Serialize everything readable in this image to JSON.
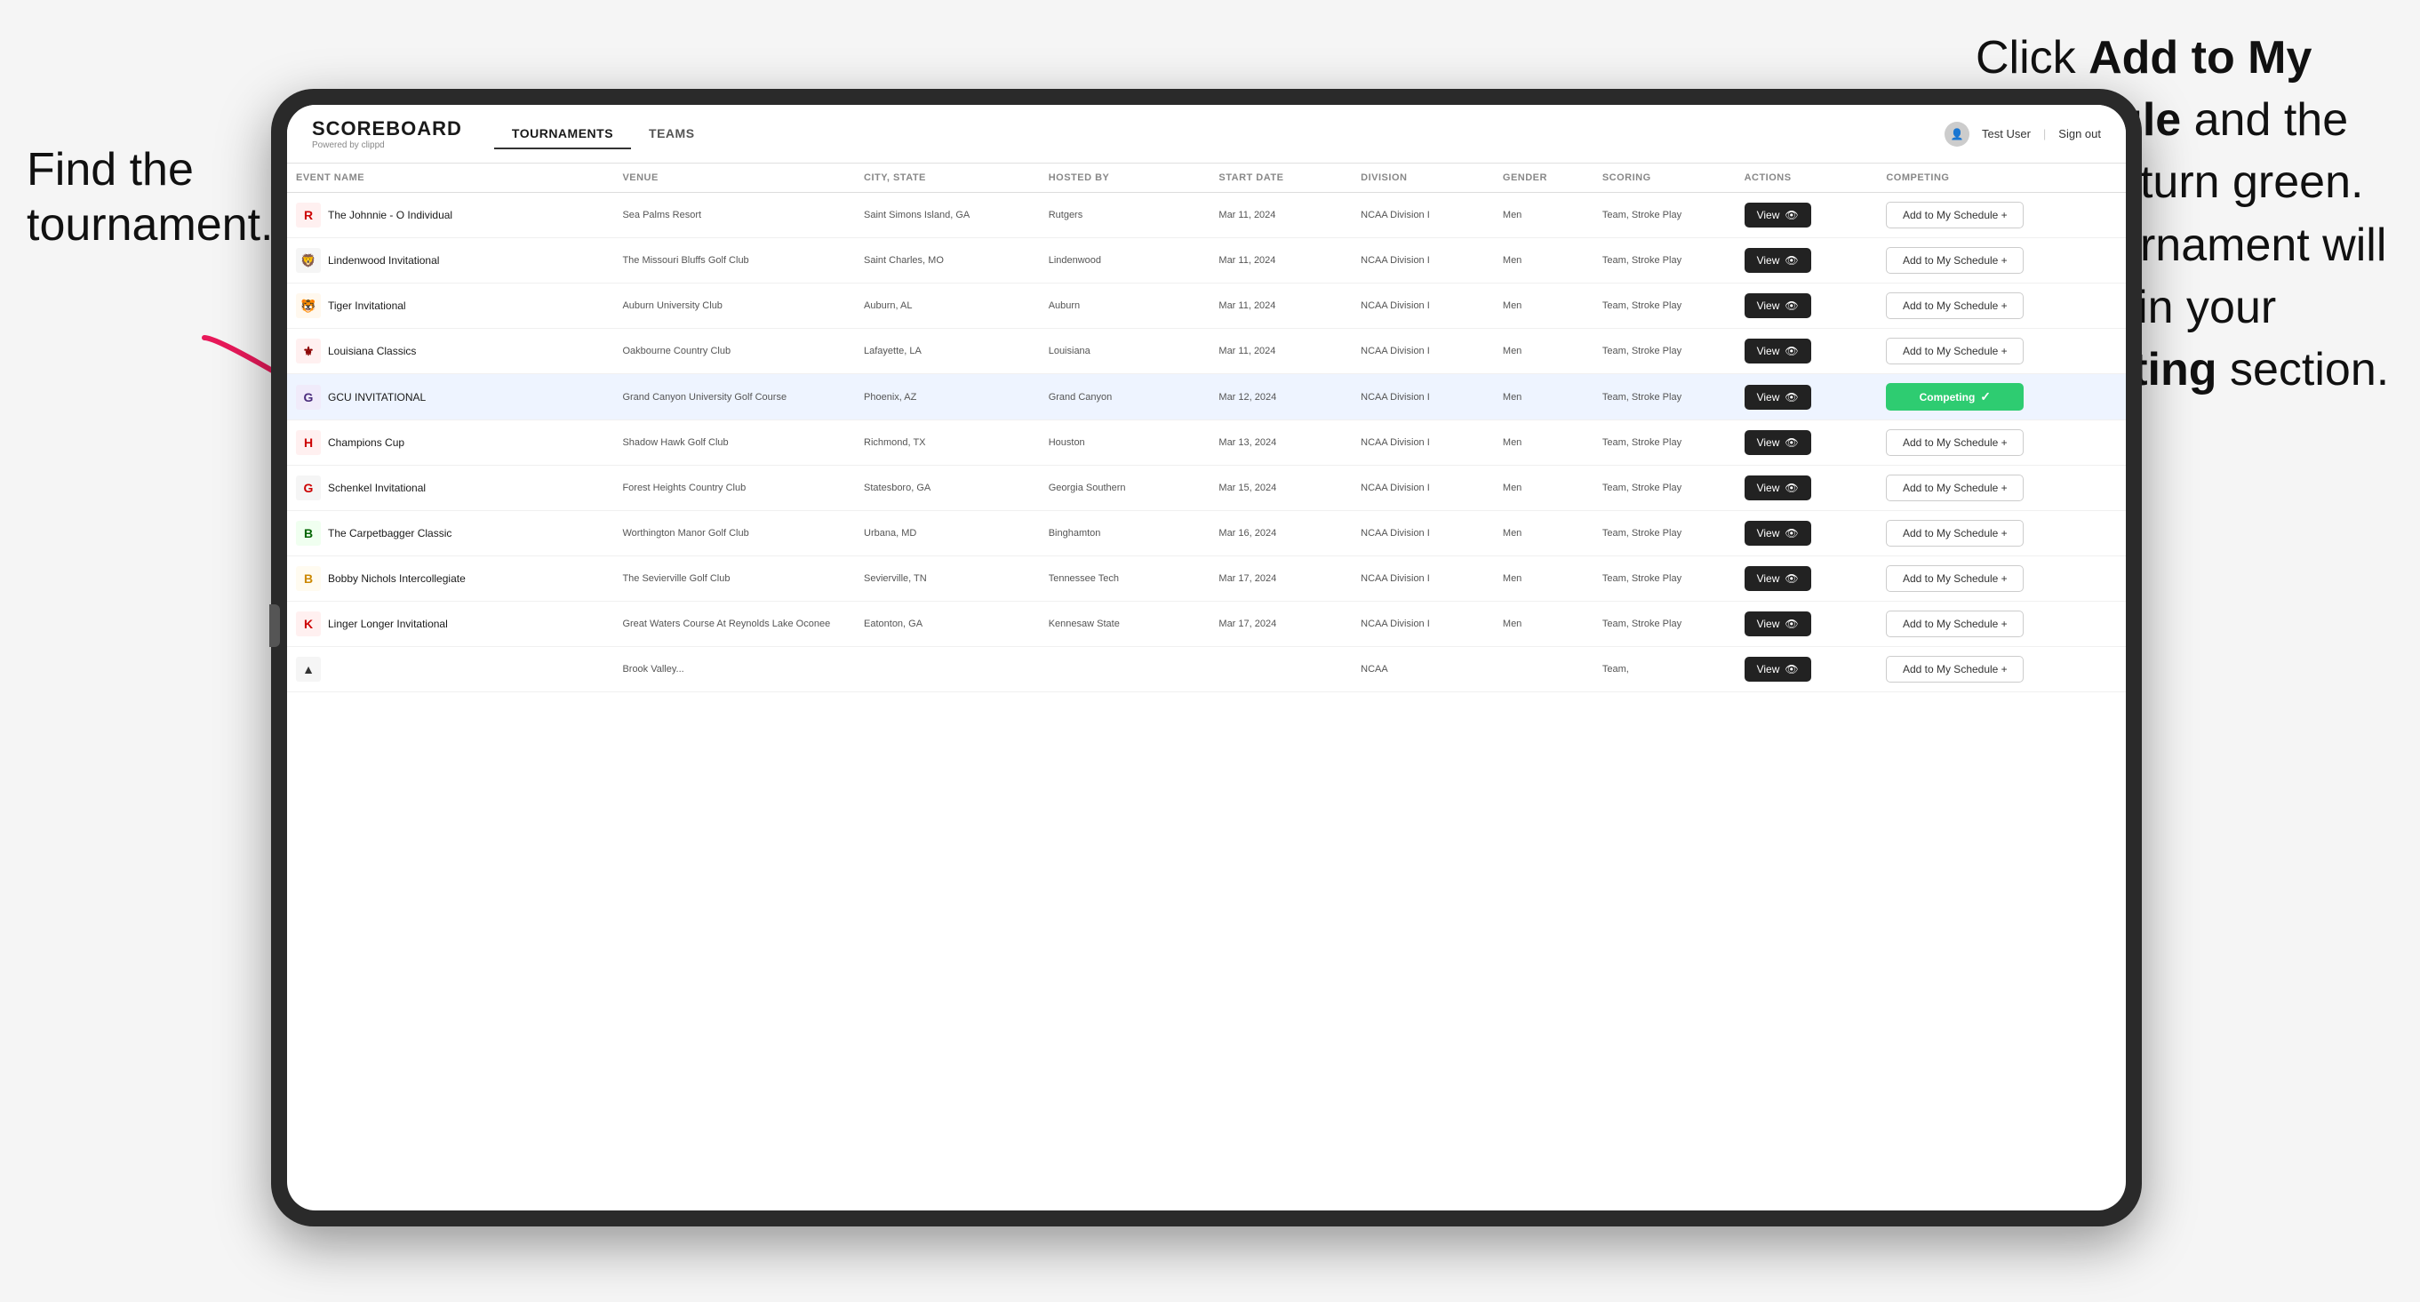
{
  "annotations": {
    "left_title": "Find the tournament.",
    "right_text_1": "Click ",
    "right_bold_1": "Add to My Schedule",
    "right_text_2": " and the box will turn green. This tournament will now be in your ",
    "right_bold_2": "Competing",
    "right_text_3": " section."
  },
  "header": {
    "brand": "SCOREBOARD",
    "brand_sub": "Powered by clippd",
    "nav_tabs": [
      "TOURNAMENTS",
      "TEAMS"
    ],
    "active_tab": "TOURNAMENTS",
    "user_name": "Test User",
    "sign_out": "Sign out"
  },
  "table": {
    "columns": [
      "EVENT NAME",
      "VENUE",
      "CITY, STATE",
      "HOSTED BY",
      "START DATE",
      "DIVISION",
      "GENDER",
      "SCORING",
      "ACTIONS",
      "COMPETING"
    ],
    "rows": [
      {
        "logo": "R",
        "logo_color": "#cc0000",
        "logo_bg": "#fff0f0",
        "event": "The Johnnie - O Individual",
        "venue": "Sea Palms Resort",
        "city": "Saint Simons Island, GA",
        "hosted": "Rutgers",
        "date": "Mar 11, 2024",
        "division": "NCAA Division I",
        "gender": "Men",
        "scoring": "Team, Stroke Play",
        "status": "add",
        "action_label": "Add to My Schedule +"
      },
      {
        "logo": "🦁",
        "logo_color": "#333",
        "logo_bg": "#f5f5f5",
        "event": "Lindenwood Invitational",
        "venue": "The Missouri Bluffs Golf Club",
        "city": "Saint Charles, MO",
        "hosted": "Lindenwood",
        "date": "Mar 11, 2024",
        "division": "NCAA Division I",
        "gender": "Men",
        "scoring": "Team, Stroke Play",
        "status": "add",
        "action_label": "Add to My Schedule +"
      },
      {
        "logo": "🐯",
        "logo_color": "#e47300",
        "logo_bg": "#fff8ee",
        "event": "Tiger Invitational",
        "venue": "Auburn University Club",
        "city": "Auburn, AL",
        "hosted": "Auburn",
        "date": "Mar 11, 2024",
        "division": "NCAA Division I",
        "gender": "Men",
        "scoring": "Team, Stroke Play",
        "status": "add",
        "action_label": "Add to My Schedule +"
      },
      {
        "logo": "⚜",
        "logo_color": "#8b0000",
        "logo_bg": "#fff0f0",
        "event": "Louisiana Classics",
        "venue": "Oakbourne Country Club",
        "city": "Lafayette, LA",
        "hosted": "Louisiana",
        "date": "Mar 11, 2024",
        "division": "NCAA Division I",
        "gender": "Men",
        "scoring": "Team, Stroke Play",
        "status": "add",
        "action_label": "Add to My Schedule +"
      },
      {
        "logo": "G",
        "logo_color": "#4a2c7c",
        "logo_bg": "#f0ebfa",
        "event": "GCU INVITATIONAL",
        "venue": "Grand Canyon University Golf Course",
        "city": "Phoenix, AZ",
        "hosted": "Grand Canyon",
        "date": "Mar 12, 2024",
        "division": "NCAA Division I",
        "gender": "Men",
        "scoring": "Team, Stroke Play",
        "status": "competing",
        "action_label": "Competing",
        "highlighted": true
      },
      {
        "logo": "H",
        "logo_color": "#cc0000",
        "logo_bg": "#fff0f0",
        "event": "Champions Cup",
        "venue": "Shadow Hawk Golf Club",
        "city": "Richmond, TX",
        "hosted": "Houston",
        "date": "Mar 13, 2024",
        "division": "NCAA Division I",
        "gender": "Men",
        "scoring": "Team, Stroke Play",
        "status": "add",
        "action_label": "Add to My Schedule +"
      },
      {
        "logo": "G",
        "logo_color": "#cc0000",
        "logo_bg": "#f5f5f5",
        "event": "Schenkel Invitational",
        "venue": "Forest Heights Country Club",
        "city": "Statesboro, GA",
        "hosted": "Georgia Southern",
        "date": "Mar 15, 2024",
        "division": "NCAA Division I",
        "gender": "Men",
        "scoring": "Team, Stroke Play",
        "status": "add",
        "action_label": "Add to My Schedule +"
      },
      {
        "logo": "B",
        "logo_color": "#006400",
        "logo_bg": "#f0fff0",
        "event": "The Carpetbagger Classic",
        "venue": "Worthington Manor Golf Club",
        "city": "Urbana, MD",
        "hosted": "Binghamton",
        "date": "Mar 16, 2024",
        "division": "NCAA Division I",
        "gender": "Men",
        "scoring": "Team, Stroke Play",
        "status": "add",
        "action_label": "Add to My Schedule +"
      },
      {
        "logo": "B",
        "logo_color": "#cc8800",
        "logo_bg": "#fffbf0",
        "event": "Bobby Nichols Intercollegiate",
        "venue": "The Sevierville Golf Club",
        "city": "Sevierville, TN",
        "hosted": "Tennessee Tech",
        "date": "Mar 17, 2024",
        "division": "NCAA Division I",
        "gender": "Men",
        "scoring": "Team, Stroke Play",
        "status": "add",
        "action_label": "Add to My Schedule +"
      },
      {
        "logo": "K",
        "logo_color": "#cc0000",
        "logo_bg": "#fff0f0",
        "event": "Linger Longer Invitational",
        "venue": "Great Waters Course At Reynolds Lake Oconee",
        "city": "Eatonton, GA",
        "hosted": "Kennesaw State",
        "date": "Mar 17, 2024",
        "division": "NCAA Division I",
        "gender": "Men",
        "scoring": "Team, Stroke Play",
        "status": "add",
        "action_label": "Add to My Schedule +"
      },
      {
        "logo": "▲",
        "logo_color": "#333",
        "logo_bg": "#f5f5f5",
        "event": "",
        "venue": "Brook Valley...",
        "city": "",
        "hosted": "",
        "date": "",
        "division": "NCAA",
        "gender": "",
        "scoring": "Team,",
        "status": "add",
        "action_label": "Add to My Schedule +"
      }
    ]
  },
  "buttons": {
    "view_label": "View",
    "competing_label": "Competing",
    "add_label": "Add to My Schedule +"
  }
}
